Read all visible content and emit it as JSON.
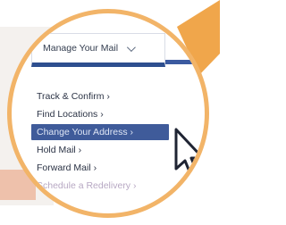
{
  "menu": {
    "title": "Manage Your Mail",
    "chevron_icon": "chevron-down-icon",
    "items": [
      {
        "label": "Track & Confirm ›"
      },
      {
        "label": "Find Locations ›"
      },
      {
        "label": "Change Your Address ›"
      },
      {
        "label": "Hold Mail ›"
      },
      {
        "label": "Forward Mail ›"
      },
      {
        "label": "Schedule a Redelivery ›"
      }
    ],
    "highlighted_index": 2
  },
  "colors": {
    "frame": "#f2b468",
    "nav_bar": "#2e4f8f",
    "highlight": "#3f5b9a",
    "pointer": "#f0a64b"
  },
  "icons": {
    "cursor": "mouse-pointer-icon"
  }
}
